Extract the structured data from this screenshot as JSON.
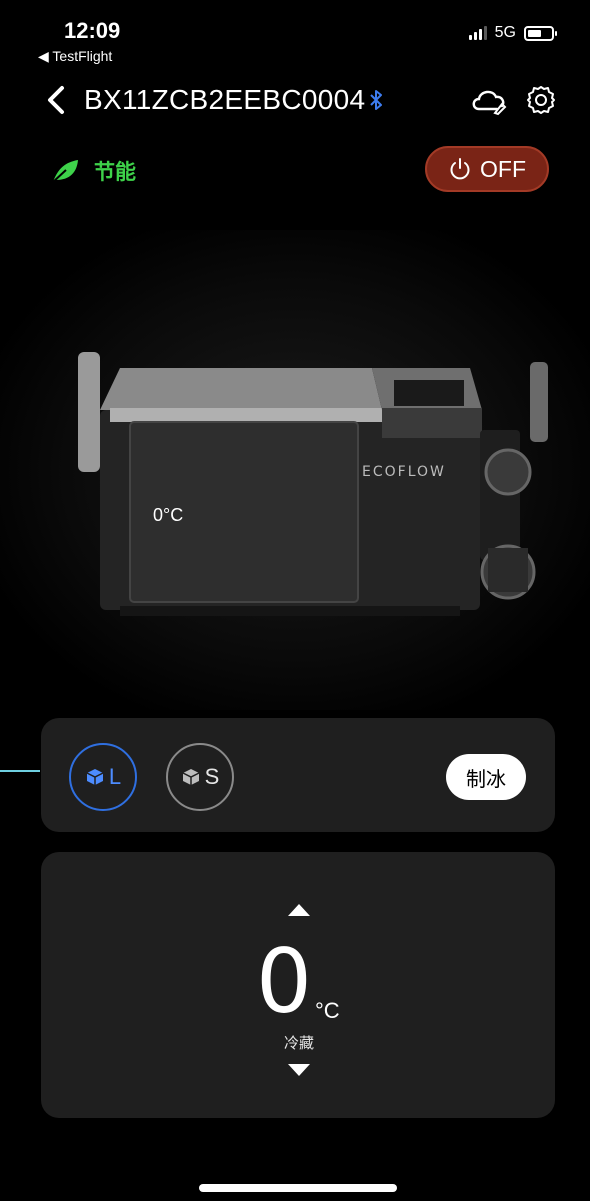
{
  "status_bar": {
    "time": "12:09",
    "back_app": "◀ TestFlight",
    "network": "5G"
  },
  "nav": {
    "title": "BX11ZCB2EEBC0004",
    "bluetooth_icon": "bluetooth-icon",
    "cloud_icon": "cloud-icon",
    "settings_icon": "gear-icon"
  },
  "eco": {
    "label": "节能",
    "color": "#3ed24a"
  },
  "power": {
    "label": "OFF",
    "color": "#7a2416"
  },
  "fridge": {
    "brand": "ECOFLOW",
    "window_temp": "0°C"
  },
  "mode": {
    "large": "L",
    "small": "S",
    "ice_label": "制冰",
    "active_color": "#2f6fe0"
  },
  "temperature": {
    "value": "0",
    "unit": "°C",
    "mode": "冷藏"
  }
}
